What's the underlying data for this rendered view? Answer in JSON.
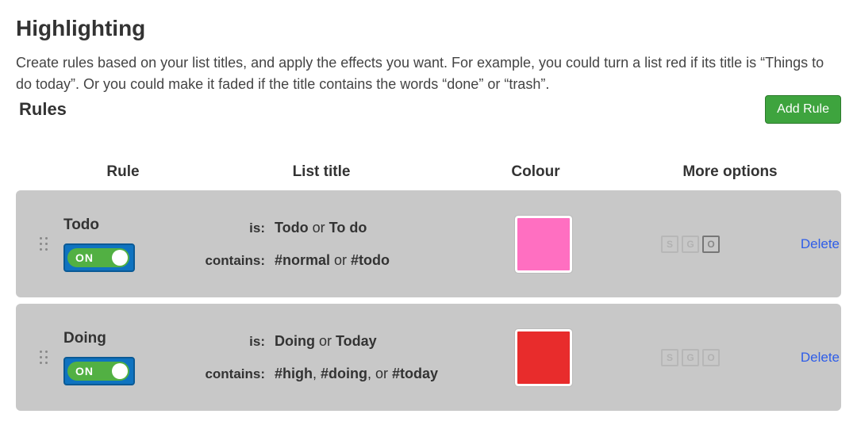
{
  "page": {
    "title": "Highlighting",
    "description": "Create rules based on your list titles, and apply the effects you want. For example, you could turn a list red if its title is “Things to do today”. Or you could make it faded if the title contains the words “done” or “trash”.",
    "rules_label": "Rules",
    "add_rule_label": "Add Rule"
  },
  "headers": {
    "rule": "Rule",
    "list_title": "List title",
    "colour": "Colour",
    "more_options": "More options"
  },
  "labels": {
    "is": "is:",
    "contains": "contains:",
    "toggle_on": "ON",
    "delete": "Delete",
    "opt_s": "S",
    "opt_g": "G",
    "opt_o": "O"
  },
  "rules": [
    {
      "name": "Todo",
      "enabled": true,
      "is_html": "<b>Todo</b> or <b>To do</b>",
      "contains_html": "<b>#normal</b> or <b>#todo</b>",
      "colour": "#ff6fc1",
      "opts": {
        "s": false,
        "g": false,
        "o": true
      }
    },
    {
      "name": "Doing",
      "enabled": true,
      "is_html": "<b>Doing</b> or <b>Today</b>",
      "contains_html": "<b>#high</b>, <b>#doing</b>, or <b>#today</b>",
      "colour": "#e82c2c",
      "opts": {
        "s": false,
        "g": false,
        "o": false
      }
    }
  ]
}
